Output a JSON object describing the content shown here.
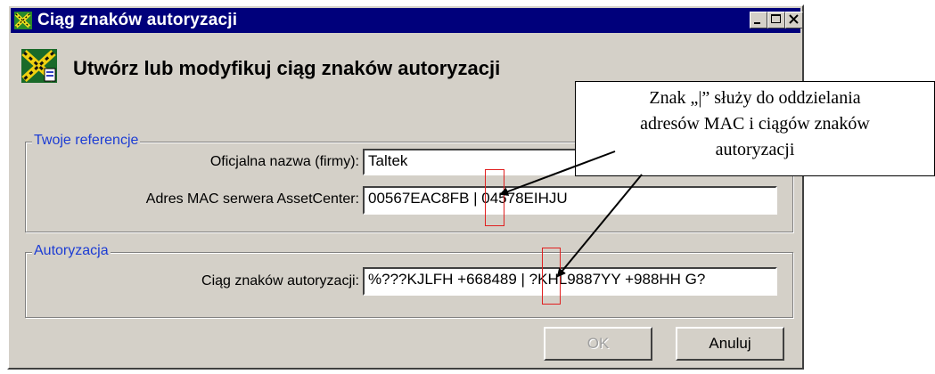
{
  "window": {
    "title": "Ciąg znaków autoryzacji"
  },
  "heading": "Utwórz lub modyfikuj ciąg znaków autoryzacji",
  "groups": {
    "references": {
      "label": "Twoje referencje",
      "company_label": "Oficjalna nazwa (firmy):",
      "company_value": "Taltek",
      "mac_label": "Adres MAC serwera AssetCenter:",
      "mac_value": "00567EAC8FB | 04578EIHJU"
    },
    "authorization": {
      "label": "Autoryzacja",
      "string_label": "Ciąg znaków autoryzacji:",
      "string_value": "%???KJLFH +668489 | ?KHL9887YY +988HH G?"
    }
  },
  "buttons": {
    "ok": "OK",
    "cancel": "Anuluj"
  },
  "callout": {
    "line1": "Znak „|” służy do oddzielania",
    "line2": "adresów MAC i ciągów znaków",
    "line3": "autoryzacji"
  },
  "colors": {
    "titlebar": "#00007b",
    "group_label": "#1c3cd4",
    "highlight": "#e02020"
  }
}
